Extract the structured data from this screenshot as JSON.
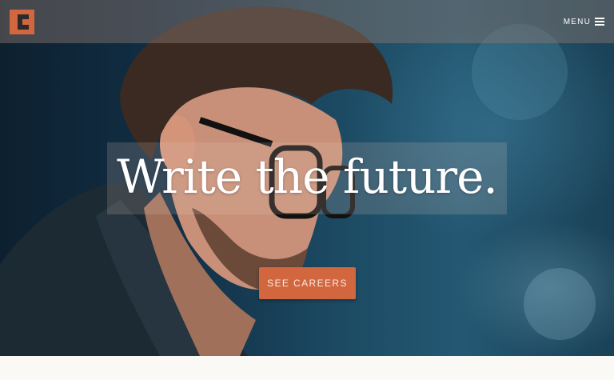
{
  "header": {
    "logo_letter": "C",
    "menu_label": "MENU"
  },
  "hero": {
    "headline": "Write the future.",
    "cta_label": "SEE CAREERS"
  },
  "colors": {
    "brand": "#d2663f",
    "hero_dark": "#123047",
    "hero_teal": "#245872",
    "text_light": "#ffffff",
    "page_bg": "#faf9f6"
  },
  "icons": {
    "logo": "c-logo-icon",
    "menu": "hamburger-menu-icon"
  }
}
